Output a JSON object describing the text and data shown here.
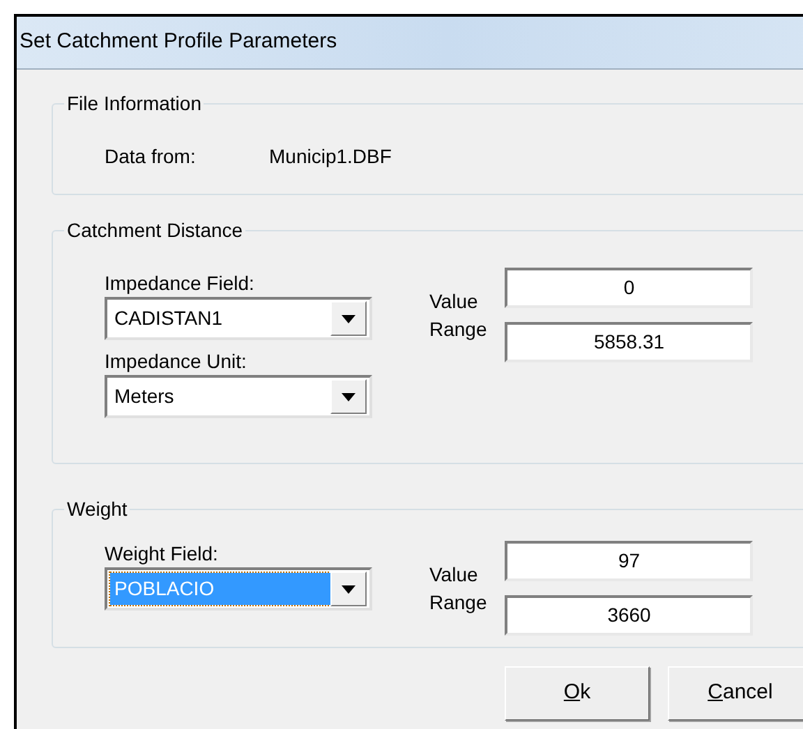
{
  "window": {
    "title": "Set Catchment Profile Parameters"
  },
  "file_information": {
    "title": "File Information",
    "label": "Data from:",
    "value": "Municip1.DBF"
  },
  "catchment_distance": {
    "title": "Catchment Distance",
    "combos": [
      {
        "label": "Impedance Field:",
        "value": "CADISTAN1",
        "focused": false
      },
      {
        "label": "Impedance Unit:",
        "value": "Meters",
        "focused": false
      }
    ],
    "range_label_1": "Value",
    "range_label_2": "Range",
    "range_min": "0",
    "range_max": "5858.31"
  },
  "weight": {
    "title": "Weight",
    "combos": [
      {
        "label": "Weight Field:",
        "value": "POBLACIO",
        "focused": true
      }
    ],
    "range_label_1": "Value",
    "range_label_2": "Range",
    "range_min": "97",
    "range_max": "3660"
  },
  "buttons": [
    {
      "label": "Ok"
    },
    {
      "label": "Cancel"
    }
  ]
}
